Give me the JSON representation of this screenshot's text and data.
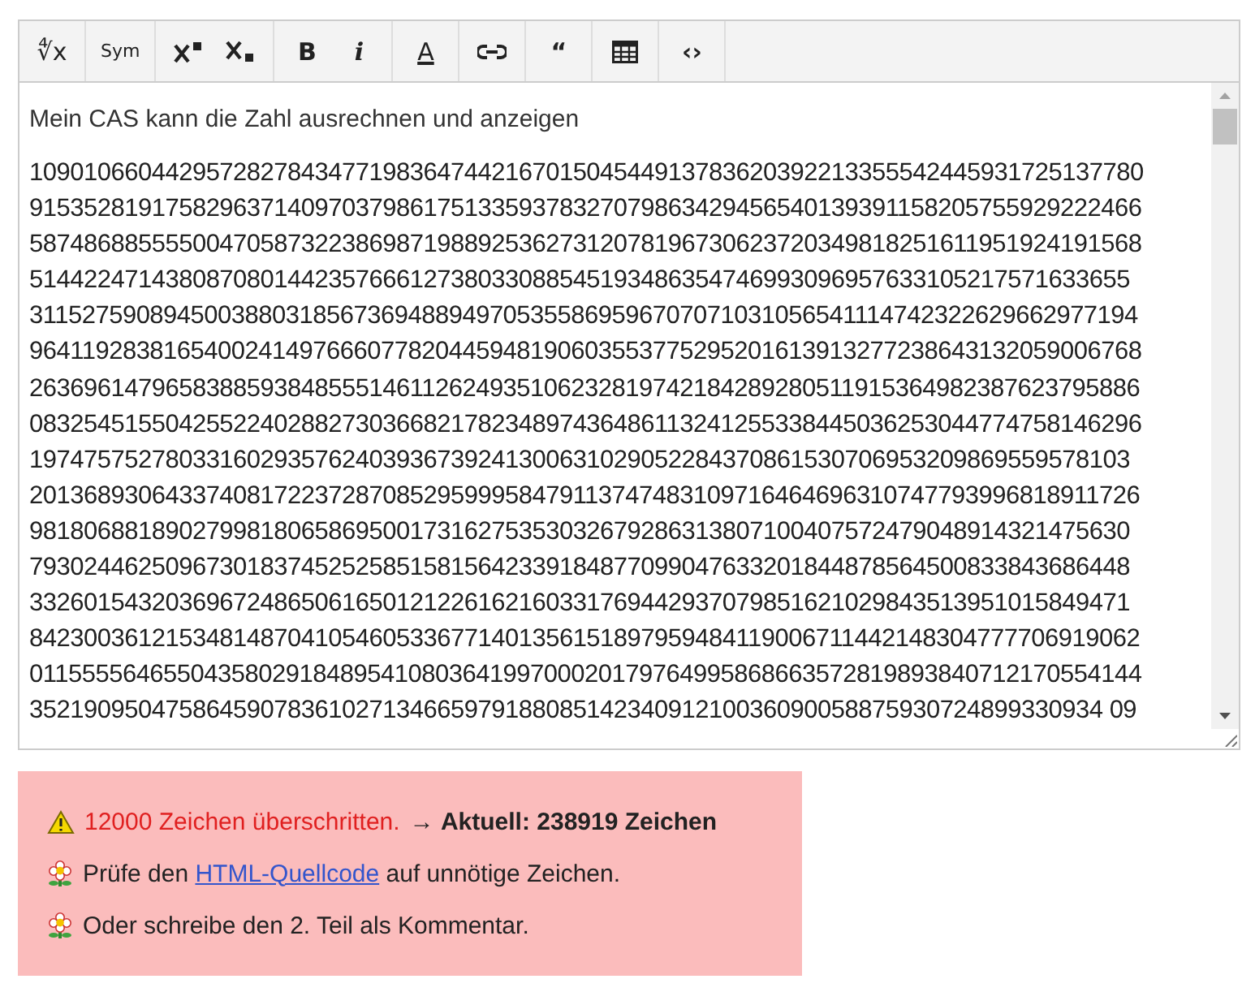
{
  "toolbar": [
    [
      {
        "kind": "root",
        "label": "∜x"
      }
    ],
    [
      {
        "kind": "symbol",
        "label": "Sym"
      }
    ],
    [
      {
        "kind": "superscript"
      },
      {
        "kind": "subscript"
      }
    ],
    [
      {
        "kind": "bold",
        "label": "B"
      },
      {
        "kind": "italic",
        "label": "i"
      }
    ],
    [
      {
        "kind": "fontcolor",
        "label": "A"
      }
    ],
    [
      {
        "kind": "link"
      }
    ],
    [
      {
        "kind": "quote",
        "label": "“"
      }
    ],
    [
      {
        "kind": "table"
      }
    ],
    [
      {
        "kind": "code",
        "label": "‹›"
      }
    ]
  ],
  "editor": {
    "heading": "Mein CAS kann die Zahl ausrechnen und anzeigen",
    "lines": [
      "1090106604429572827843477198364744216701504544913783620392213355542445931725137780",
      "9153528191758296371409703798617513359378327079863429456540139391158205755929222466",
      "5874868855550047058732238698719889253627312078196730623720349818251611951924191568",
      "514422471438087080144235766612738033088545193486354746993096957633105217571633655",
      "3115275908945003880318567369488949705355869596707071031056541114742322629662977194",
      "9641192838165400241497666077820445948190603553775295201613913277238643132059006768",
      "2636961479658388593848555146112624935106232819742184289280511915364982387623795886",
      "0832545155042552240288273036682178234897436486113241255338445036253044774758146296",
      "197475752780331602935762403936739241300631029052284370861530706953209869559578103",
      "2013689306433740817223728708529599958479113747483109716464696310747793996818911726",
      "981806881890279981806586950017316275353032679286313807100407572479048914321475630",
      "793024462509673018374525258515815642339184877099047633201844878564500833843686448",
      "332601543203696724865061650121226162160331769442937079851621029843513951015849471",
      "8423003612153481487041054605336771401356151897959484119006711442148304777706919062",
      "0115555646550435802918489541080364199700020179764995868663572819893840712170554144",
      "3521909504758645907836102713466597918808514234091210036090058875930724899330934 09"
    ]
  },
  "alert": [
    {
      "kind": "warning",
      "highlight": "12000 Zeichen überschritten.",
      "text": "→ **Aktuell: 238919 Zeichen**"
    },
    {
      "kind": "flower",
      "text": "Prüfe den ",
      "link": "HTML-Quellcode",
      "after": " auf unnötige Zeichen."
    },
    {
      "kind": "flower",
      "text": "Oder schreibe den 2. Teil als Kommentar."
    }
  ]
}
